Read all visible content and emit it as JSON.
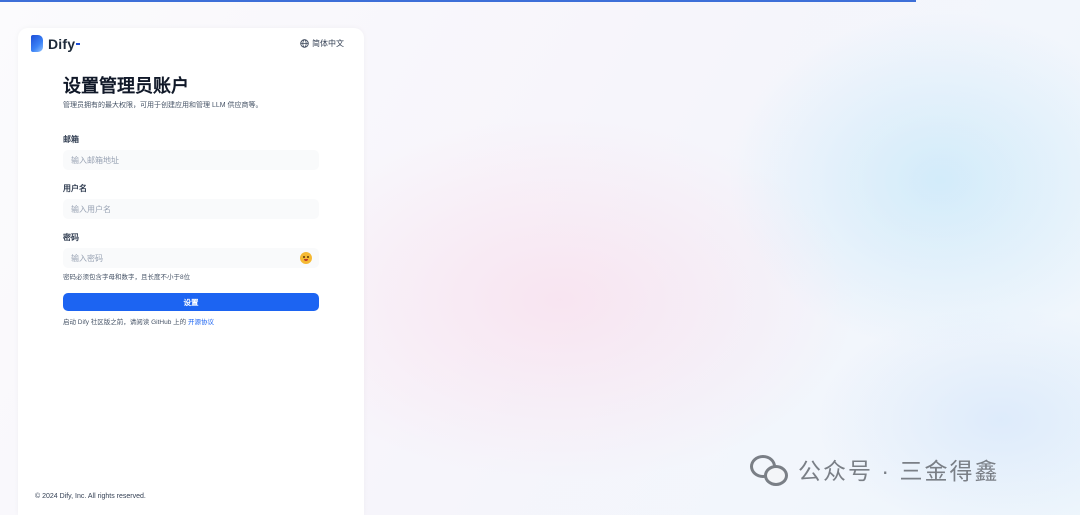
{
  "app": {
    "brand": "Dify",
    "language_label": "简体中文"
  },
  "form": {
    "title": "设置管理员账户",
    "subtitle": "管理员拥有的最大权限，可用于创建应用和管理 LLM 供应商等。",
    "email": {
      "label": "邮箱",
      "placeholder": "输入邮箱地址",
      "value": ""
    },
    "username": {
      "label": "用户名",
      "placeholder": "输入用户名",
      "value": ""
    },
    "password": {
      "label": "密码",
      "placeholder": "输入密码",
      "value": "",
      "hint": "密码必须包含字母和数字，且长度不小于8位"
    },
    "submit_label": "设置",
    "agreement_prefix": "启动 Dify 社区版之前，请阅读 GitHub 上的",
    "agreement_link": "开源协议"
  },
  "footer": {
    "copyright": "© 2024 Dify, Inc. All rights reserved."
  },
  "watermark": {
    "text": "公众号 · 三金得鑫"
  },
  "colors": {
    "accent": "#1c64f2",
    "top_bar": "#3d6fd8"
  },
  "icons": {
    "language": "globe-icon",
    "password_toggle": "eye-toggle-icon",
    "watermark": "wechat-icon"
  }
}
